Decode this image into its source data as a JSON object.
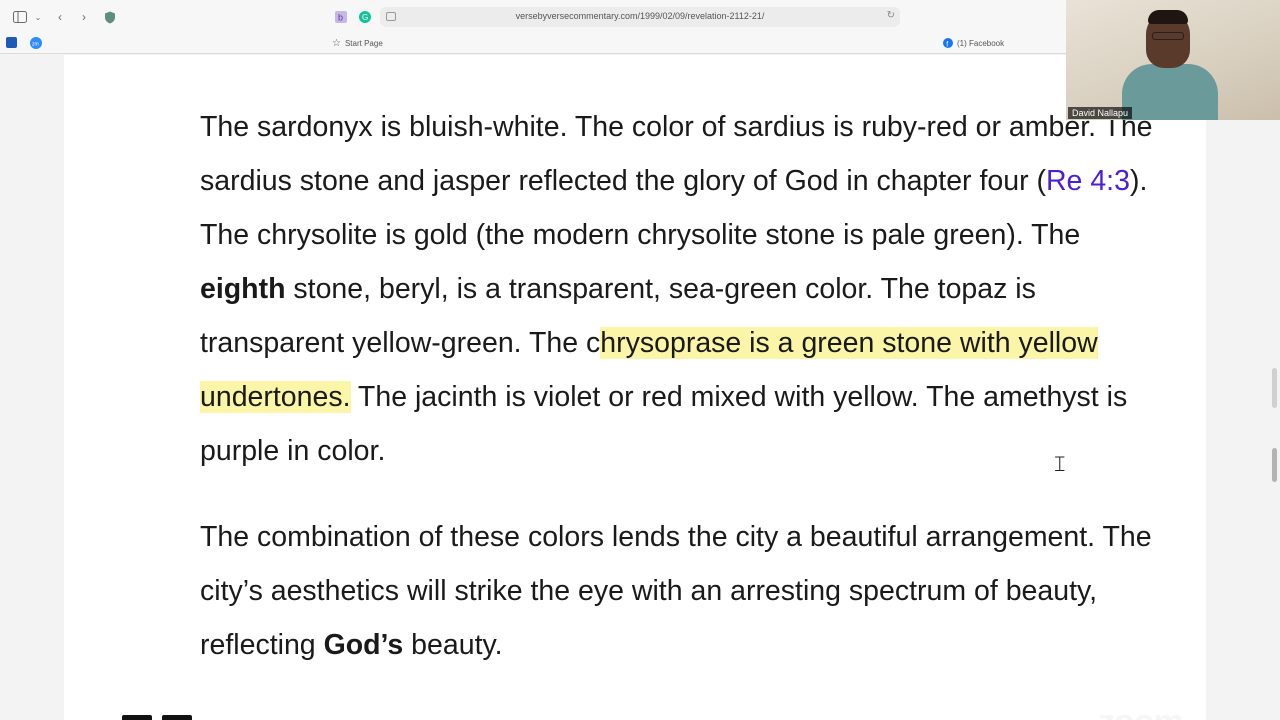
{
  "browser": {
    "url": "versebyversecommentary.com/1999/02/09/revelation-2112-21/",
    "bookmarks": {
      "start_page": "Start Page",
      "facebook": "(1) Facebook"
    }
  },
  "video": {
    "participant_name": "David Nallapu"
  },
  "article": {
    "para1": {
      "s1": "The sardonyx is bluish-white. The color of sardius is ruby-red or amber. The sardius stone and jasper reflected the glory of God in chapter four (",
      "link": "Re 4:3",
      "s2": "). The chrysolite is gold (the modern chrysolite stone is pale green). The ",
      "bold": "eighth",
      "s3": " stone, beryl, is a transparent, sea-green color. The topaz is transparent yellow-green. The c",
      "highlight": "hrysoprase is a green stone with yellow undertones.",
      "s4": " The jacinth is violet or red mixed with yellow. The amethyst is purple in color."
    },
    "para2": {
      "s1": "The combination of these colors lends the city a beautiful arrangement. The city’s aesthetics will strike the eye with an arresting spectrum of beauty, reflecting ",
      "bold": "God’s",
      "s2": " beauty."
    }
  },
  "watermark": "zoom",
  "colors": {
    "link": "#4d1ed8",
    "highlight": "#fbf5a8"
  }
}
